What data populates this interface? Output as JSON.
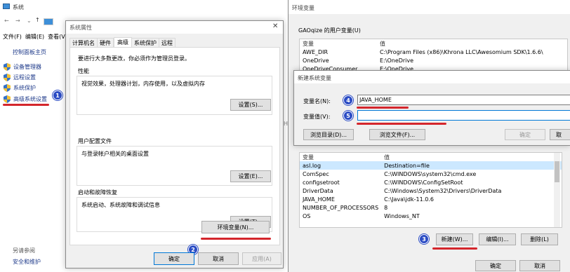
{
  "explorer": {
    "title": "系统",
    "menu": [
      "文件(F)",
      "编辑(E)",
      "查看(V"
    ],
    "sidebar_home": "控制面板主页",
    "sidebar_items": [
      "设备管理器",
      "远程设置",
      "系统保护",
      "高级系统设置"
    ],
    "see_also": "另请参阅",
    "security": "安全和维护"
  },
  "sysprops": {
    "title": "系统属性",
    "tabs": [
      "计算机名",
      "硬件",
      "高级",
      "系统保护",
      "远程"
    ],
    "note": "要进行大多数更改，你必须作为管理员登录。",
    "perf_title": "性能",
    "perf_desc": "视觉效果，处理器计划，内存使用，以及虚拟内存",
    "perf_btn": "设置(S)...",
    "profile_title": "用户配置文件",
    "profile_desc": "与登录帐户相关的桌面设置",
    "profile_btn": "设置(E)...",
    "startup_title": "启动和故障恢复",
    "startup_desc": "系统启动、系统故障和调试信息",
    "startup_btn": "设置(T)...",
    "env_btn": "环境变量(N)...",
    "ok": "确定",
    "cancel": "取消",
    "apply": "应用(A)"
  },
  "envvars": {
    "title": "环境变量",
    "user_group": "GAOqize 的用户变量(U)",
    "col_var": "变量",
    "col_val": "值",
    "user_rows": [
      {
        "var": "AWE_DIR",
        "val": "C:\\Program Files (x86)\\Khrona LLC\\Awesomium SDK\\1.6.6\\"
      },
      {
        "var": "OneDrive",
        "val": "E:\\OneDrive"
      },
      {
        "var": "OneDriveConsumer",
        "val": "E:\\OneDrive"
      }
    ],
    "sys_rows": [
      {
        "var": "asl.log",
        "val": "Destination=file"
      },
      {
        "var": "ComSpec",
        "val": "C:\\WINDOWS\\system32\\cmd.exe"
      },
      {
        "var": "configsetroot",
        "val": "C:\\WINDOWS\\ConfigSetRoot"
      },
      {
        "var": "DriverData",
        "val": "C:\\Windows\\System32\\Drivers\\DriverData"
      },
      {
        "var": "JAVA_HOME",
        "val": "C:\\Java\\jdk-11.0.6"
      },
      {
        "var": "NUMBER_OF_PROCESSORS",
        "val": "8"
      },
      {
        "var": "OS",
        "val": "Windows_NT"
      }
    ],
    "new_btn": "新建(W)...",
    "edit_btn": "编辑(I)...",
    "delete_btn": "删除(L)",
    "ok": "确定",
    "cancel": "取消"
  },
  "newvar": {
    "title": "新建系统变量",
    "name_label": "变量名(N):",
    "name_value": "JAVA_HOME",
    "value_label": "变量值(V):",
    "value_value": "",
    "browse_dir": "浏览目录(D)...",
    "browse_file": "浏览文件(F)...",
    "ok": "确定",
    "cancel": "取"
  },
  "badges": [
    "1",
    "2",
    "3",
    "4",
    "5"
  ],
  "colors": {
    "accent": "#0078d7",
    "underline": "#d4262c",
    "badge": "#2b4cc4",
    "selection": "#cce8ff"
  }
}
